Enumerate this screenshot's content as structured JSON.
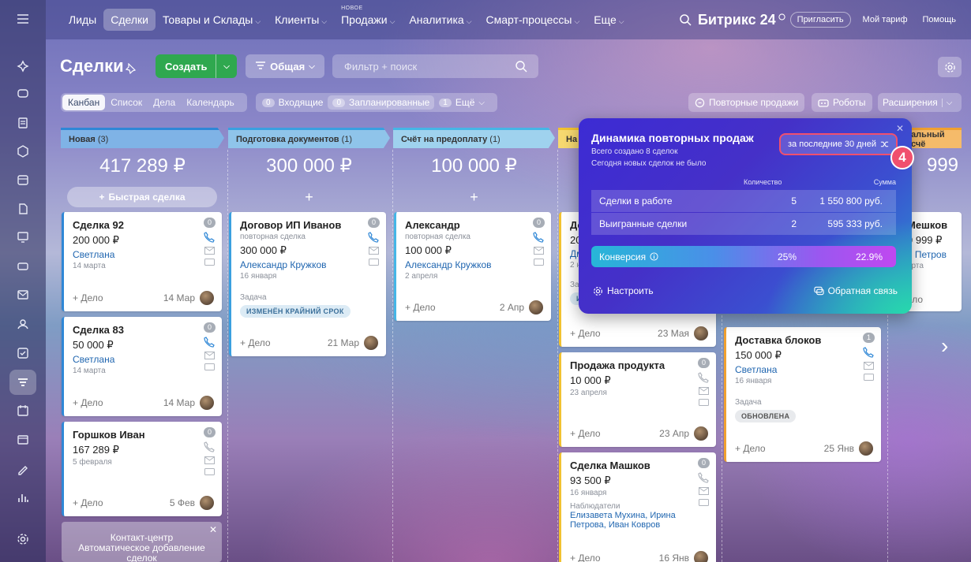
{
  "nav": {
    "items": [
      {
        "label": "Лиды",
        "chevron": false
      },
      {
        "label": "Сделки",
        "chevron": false,
        "active": true
      },
      {
        "label": "Товары и Склады",
        "chevron": true
      },
      {
        "label": "Клиенты",
        "chevron": true
      },
      {
        "label": "Продажи",
        "chevron": true,
        "new_label": "НОВОЕ"
      },
      {
        "label": "Аналитика",
        "chevron": true
      },
      {
        "label": "Смарт-процессы",
        "chevron": true
      },
      {
        "label": "Еще",
        "chevron": true
      }
    ],
    "brand": "Битрикс 24",
    "invite": "Пригласить",
    "tariff": "Мой тариф",
    "help": "Помощь"
  },
  "header": {
    "title": "Сделки",
    "create": "Создать",
    "general": "Общая",
    "search_placeholder": "Фильтр + поиск"
  },
  "views": [
    "Канбан",
    "Список",
    "Дела",
    "Календарь"
  ],
  "counters": [
    {
      "count": "0",
      "label": "Входящие"
    },
    {
      "count": "0",
      "label": "Запланированные"
    },
    {
      "count": "1",
      "label": "Ещё"
    }
  ],
  "tools": {
    "repeat_sales": "Повторные продажи",
    "robots": "Роботы",
    "extensions": "Расширения"
  },
  "columns": [
    {
      "name": "Новая",
      "count": "(3)",
      "sum": "417 289 ₽",
      "color": "#2f87d6",
      "quick": "Быстрая сделка"
    },
    {
      "name": "Подготовка документов",
      "count": "(1)",
      "sum": "300 000 ₽",
      "color": "#3aa0e0"
    },
    {
      "name": "Счёт на предоплату",
      "count": "(1)",
      "sum": "100 000 ₽",
      "color": "#45b6e6"
    },
    {
      "name": "На",
      "count": "",
      "sum": "",
      "color": "#f2c230"
    },
    {
      "name": "альный счё",
      "count": "",
      "sum": "999",
      "color": "#f0a030"
    }
  ],
  "cards": {
    "c92": {
      "title": "Сделка 92",
      "price": "200 000 ₽",
      "contact": "Светлана",
      "date": "14 марта",
      "add": "+ Дело",
      "foot_date": "14 Мар",
      "badge": "0"
    },
    "c83": {
      "title": "Сделка 83",
      "price": "50 000 ₽",
      "contact": "Светлана",
      "date": "14 марта",
      "add": "+ Дело",
      "foot_date": "14 Мар",
      "badge": "0"
    },
    "gorshkov": {
      "title": "Горшков Иван",
      "price": "167 289 ₽",
      "date": "5 февраля",
      "add": "+ Дело",
      "foot_date": "5 Фев",
      "badge": "0"
    },
    "ivanov": {
      "title": "Договор ИП Иванов",
      "sub": "повторная сделка",
      "price": "300 000 ₽",
      "contact": "Александр Кружков",
      "date": "16 января",
      "task": "Задача",
      "tag": "ИЗМЕНЁН КРАЙНИЙ СРОК",
      "add": "+ Дело",
      "foot_date": "21 Мар",
      "badge": "0"
    },
    "alexandr": {
      "title": "Александр",
      "sub": "повторная сделка",
      "price": "100 000 ₽",
      "contact": "Александр Кружков",
      "date": "2 апреля",
      "add": "+ Дело",
      "foot_date": "2 Апр",
      "badge": "0"
    },
    "col4a": {
      "title": "До",
      "price": "20",
      "contact": "Дм",
      "date": "2 н",
      "task": "За",
      "tag": "И",
      "add": "+ Дело",
      "foot_date": "23 Мая"
    },
    "product": {
      "title": "Продажа продукта",
      "price": "10 000 ₽",
      "date": "23 апреля",
      "add": "+ Дело",
      "foot_date": "23 Апр",
      "badge": "0"
    },
    "mashkov": {
      "title": "Сделка Машков",
      "price": "93 500 ₽",
      "date": "16 января",
      "watch_lbl": "Наблюдатели",
      "watchers": "Елизавета Мухина, Ирина Петрова, Иван Ковров",
      "add": "+ Дело",
      "foot_date": "16 Янв",
      "badge": "0"
    },
    "col5a": {
      "title": "Мешков",
      "price": "9 999 ₽",
      "contact": "я Петров",
      "date": "арта",
      "add": "ело"
    },
    "blocks": {
      "title": "Доставка блоков",
      "price": "150 000 ₽",
      "contact": "Светлана",
      "date": "16 января",
      "task": "Задача",
      "tag": "ОБНОВЛЕНА",
      "add": "+ Дело",
      "foot_date": "25 Янв",
      "badge": "1"
    }
  },
  "popup": {
    "title": "Динамика повторных продаж",
    "line1": "Всего создано 8 сделок",
    "line2": "Сегодня новых сделок не было",
    "period": "за последние 30 дней",
    "col_qty": "Количество",
    "col_sum": "Сумма",
    "rows": [
      {
        "name": "Сделки в работе",
        "qty": "5",
        "sum": "1 550 800 руб."
      },
      {
        "name": "Выигранные сделки",
        "qty": "2",
        "sum": "595 333 руб."
      }
    ],
    "conversion": {
      "name": "Конверсия",
      "qty": "25%",
      "sum": "22.9%"
    },
    "configure": "Настроить",
    "feedback": "Обратная связь",
    "step": "4"
  },
  "contact_center": {
    "line1": "Контакт-центр",
    "line2": "Автоматическое добавление",
    "line3": "сделок"
  }
}
